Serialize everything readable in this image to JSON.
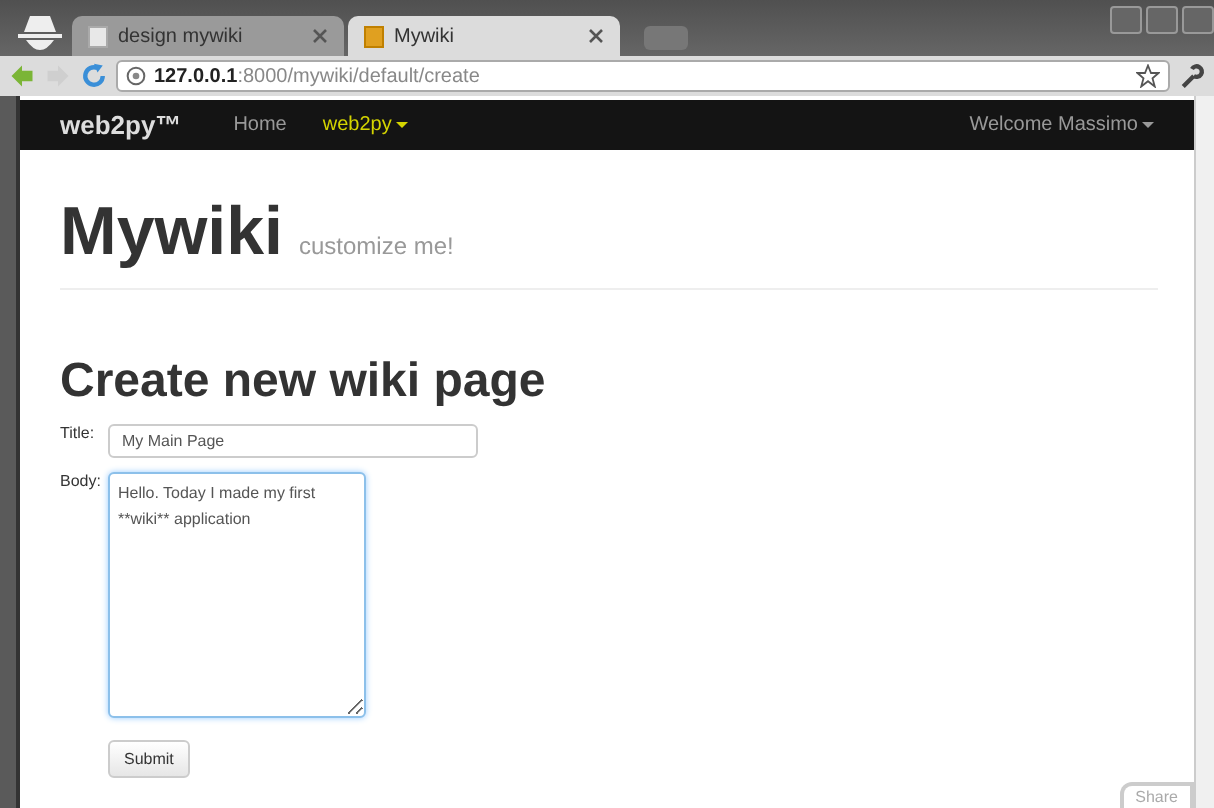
{
  "browser": {
    "tabs": [
      {
        "label": "design mywiki",
        "selected": false
      },
      {
        "label": "Mywiki",
        "selected": true
      }
    ],
    "address": {
      "host": "127.0.0.1",
      "path": ":8000/mywiki/default/create"
    }
  },
  "navbar": {
    "brand": "web2py™",
    "items": [
      {
        "label": "Home",
        "selected": false,
        "dropdown": false
      },
      {
        "label": "web2py",
        "selected": true,
        "dropdown": true
      }
    ],
    "user": "Welcome Massimo"
  },
  "header": {
    "title": "Mywiki",
    "subtitle": "customize me!"
  },
  "form": {
    "heading": "Create new wiki page",
    "fields": [
      {
        "label": "Title:",
        "kind": "input",
        "value": "My Main Page",
        "focused": false
      },
      {
        "label": "Body:",
        "kind": "textarea",
        "value": "Hello. Today I made my first\n**wiki** application",
        "focused": true
      }
    ],
    "submit": "Submit"
  },
  "share": "Share"
}
